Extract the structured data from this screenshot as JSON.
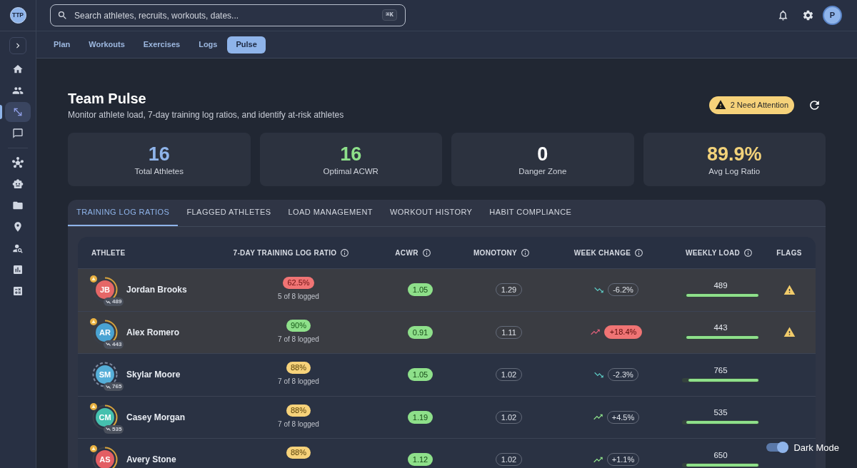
{
  "sidebar": {
    "logo": "TTP",
    "primary_items": [
      {
        "selected": false
      },
      {
        "selected": false
      },
      {
        "selected": true
      },
      {
        "selected": false
      }
    ],
    "secondary_items": [
      {
        "selected": false
      },
      {
        "selected": false
      },
      {
        "selected": false
      },
      {
        "selected": false
      },
      {
        "selected": false
      },
      {
        "selected": false
      },
      {
        "selected": false
      }
    ]
  },
  "topbar": {
    "search": {
      "placeholder": "Search athletes, recruits, workouts, dates...",
      "shortcut": "⌘K"
    },
    "avatar": "P"
  },
  "nav_tabs": [
    {
      "label": "Plan",
      "selected": false
    },
    {
      "label": "Workouts",
      "selected": false
    },
    {
      "label": "Exercises",
      "selected": false
    },
    {
      "label": "Logs",
      "selected": false
    },
    {
      "label": "Pulse",
      "selected": true
    }
  ],
  "header": {
    "title": "Team Pulse",
    "subtitle": "Monitor athlete load, 7-day training log ratios, and identify at-risk athletes",
    "attention": "2 Need Attention"
  },
  "stats": [
    {
      "value": "16",
      "label": "Total Athletes",
      "color": "#8fb4ea"
    },
    {
      "value": "16",
      "label": "Optimal ACWR",
      "color": "#8ee08a"
    },
    {
      "value": "0",
      "label": "Danger Zone",
      "color": "#ffffff"
    },
    {
      "value": "89.9%",
      "label": "Avg Log Ratio",
      "color": "#f2d27a"
    }
  ],
  "panel_tabs": [
    {
      "label": "TRAINING LOG RATIOS",
      "selected": true
    },
    {
      "label": "FLAGGED ATHLETES",
      "selected": false
    },
    {
      "label": "LOAD MANAGEMENT",
      "selected": false
    },
    {
      "label": "WORKOUT HISTORY",
      "selected": false
    },
    {
      "label": "HABIT COMPLIANCE",
      "selected": false
    }
  ],
  "table": {
    "columns": [
      {
        "label": "ATHLETE",
        "info": false
      },
      {
        "label": "7-DAY TRAINING LOG RATIO",
        "info": true
      },
      {
        "label": "ACWR",
        "info": true
      },
      {
        "label": "MONOTONY",
        "info": true
      },
      {
        "label": "WEEK CHANGE",
        "info": true
      },
      {
        "label": "WEEKLY LOAD",
        "info": true
      },
      {
        "label": "FLAGS",
        "info": false
      }
    ],
    "rows": [
      {
        "flagged": true,
        "athlete": {
          "initials": "JB",
          "name": "Jordan Brooks",
          "color": "#e56767",
          "alert": true,
          "ring": {
            "kind": "arc"
          },
          "load_badge": "489"
        },
        "log_ratio": {
          "value": "62.5%",
          "kind": "danger",
          "detail": "5 of 8 logged"
        },
        "acwr": "1.05",
        "monotony": "1.29",
        "week_change": {
          "value": "-6.2%",
          "kind": "down",
          "alert": false
        },
        "weekly_load": {
          "value": "489",
          "level": 0.95
        }
      },
      {
        "flagged": true,
        "athlete": {
          "initials": "AR",
          "name": "Alex Romero",
          "color": "#4aa3d3",
          "alert": true,
          "ring": {
            "kind": "arc"
          },
          "load_badge": "443"
        },
        "log_ratio": {
          "value": "90%",
          "kind": "good",
          "detail": "7 of 8 logged"
        },
        "acwr": "0.91",
        "monotony": "1.11",
        "week_change": {
          "value": "+18.4%",
          "kind": "up",
          "alert": true
        },
        "weekly_load": {
          "value": "443",
          "level": 0.95
        }
      },
      {
        "flagged": false,
        "athlete": {
          "initials": "SM",
          "name": "Skylar Moore",
          "color": "#55aed8",
          "alert": false,
          "ring": {
            "kind": "dashed"
          },
          "load_badge": "765"
        },
        "log_ratio": {
          "value": "88%",
          "kind": "warning",
          "detail": "7 of 8 logged"
        },
        "acwr": "1.05",
        "monotony": "1.02",
        "week_change": {
          "value": "-2.3%",
          "kind": "down",
          "alert": false
        },
        "weekly_load": {
          "value": "765",
          "level": 0.92
        }
      },
      {
        "flagged": false,
        "athlete": {
          "initials": "CM",
          "name": "Casey Morgan",
          "color": "#45c0ae",
          "alert": true,
          "ring": {
            "kind": "arc"
          },
          "load_badge": "535"
        },
        "log_ratio": {
          "value": "88%",
          "kind": "warning",
          "detail": "7 of 8 logged"
        },
        "acwr": "1.19",
        "monotony": "1.02",
        "week_change": {
          "value": "+4.5%",
          "kind": "up",
          "alert": false
        },
        "weekly_load": {
          "value": "535",
          "level": 0.95
        }
      },
      {
        "flagged": false,
        "athlete": {
          "initials": "AS",
          "name": "Avery Stone",
          "color": "#e35e64",
          "alert": true,
          "ring": {
            "kind": "arc"
          }
        },
        "log_ratio": {
          "value": "88%",
          "kind": "warning"
        },
        "acwr": "1.12",
        "monotony": "1.02",
        "week_change": {
          "value": "+1.1%",
          "kind": "up",
          "alert": false
        },
        "weekly_load": {
          "value": "650",
          "level": 0.95
        }
      }
    ]
  },
  "dark_mode": {
    "label": "Dark Mode",
    "on": true
  }
}
